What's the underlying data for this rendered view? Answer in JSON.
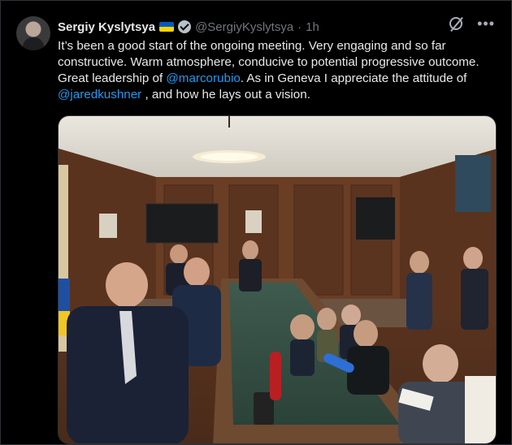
{
  "tweet": {
    "author_name": "Sergiy Kyslytsya",
    "handle": "@SergiyKyslytsya",
    "separator": "·",
    "time": "1h",
    "text_parts": [
      "It’s been a good start of the ongoing meeting. Very engaging and so far constructive. Warm atmosphere, conducive to potential progressive outcome. Great leadership of ",
      "@marcorubio",
      ". As in Geneva I appreciate the attitude of ",
      "@jaredkushner",
      " , and how he lays out a vision."
    ],
    "more_label": "•••"
  },
  "icons": {
    "verified": "verified-badge-icon",
    "flag": "ukraine-flag-icon",
    "grok": "grok-icon",
    "more": "more-options-icon"
  },
  "colors": {
    "background": "#000000",
    "text": "#e7e9ea",
    "muted": "#71767b",
    "link": "#1d9bf0",
    "flag_blue": "#005bbb",
    "flag_yellow": "#ffd500"
  }
}
